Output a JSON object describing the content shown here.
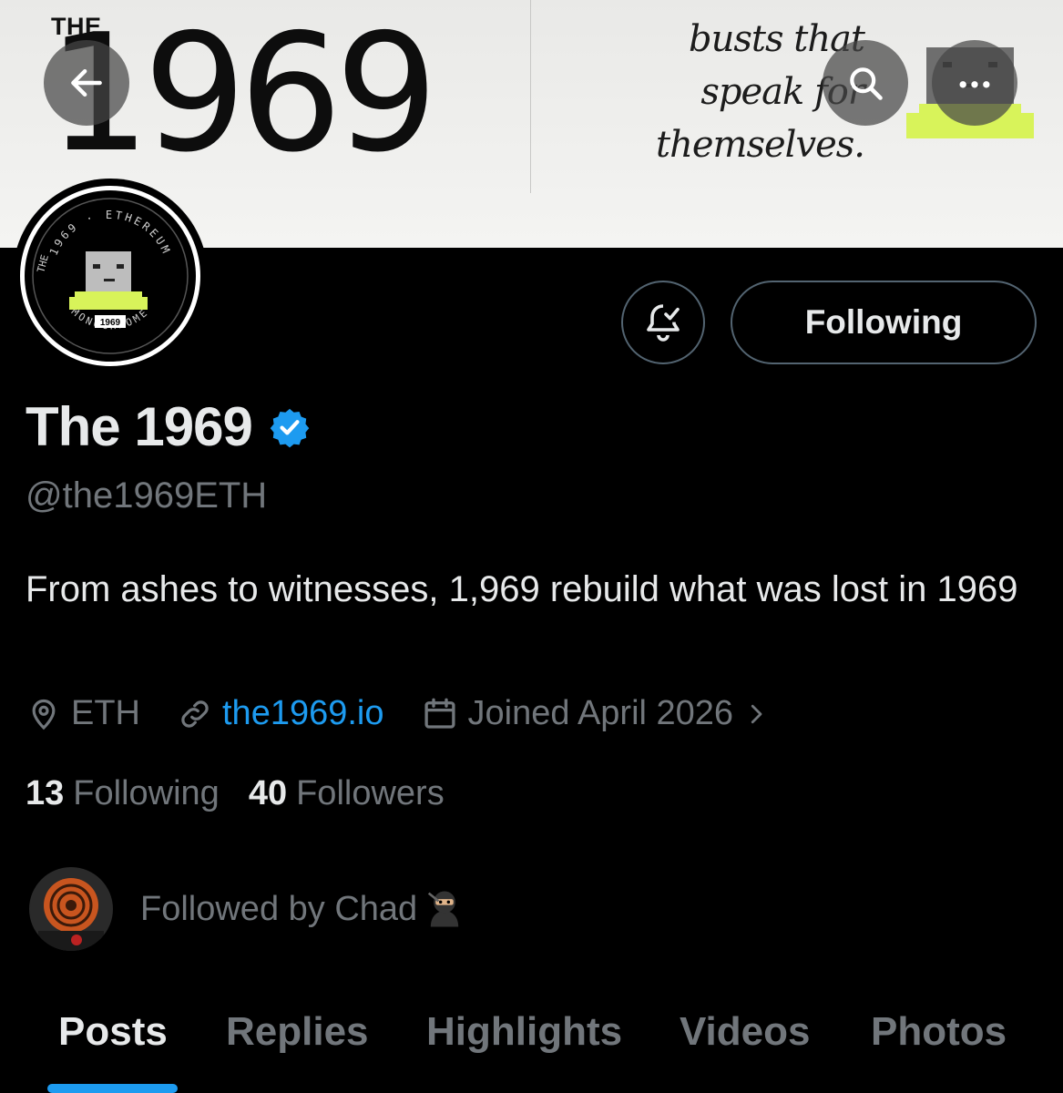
{
  "banner": {
    "the_label": "THE",
    "big_number": "1969",
    "tagline_lines": [
      "busts that",
      "speak for",
      "themselves."
    ]
  },
  "avatar_logo": {
    "ring_text_top": "1969 · ETHEREUM",
    "ring_text_left": "THE",
    "ring_text_bottom": "MONOCHROME",
    "badge": "1969"
  },
  "header_buttons": {
    "back_icon": "arrow-left-icon",
    "search_icon": "search-icon",
    "more_icon": "more-horizontal-icon"
  },
  "actions": {
    "notify_icon": "bell-check-icon",
    "following_label": "Following"
  },
  "profile": {
    "display_name": "The 1969",
    "verified": true,
    "handle": "@the1969ETH",
    "bio": "From ashes to witnesses, 1,969 rebuild what was lost in 1969",
    "location": "ETH",
    "website": "the1969.io",
    "joined": "Joined April 2026",
    "following_count": "13",
    "following_label": "Following",
    "followers_count": "40",
    "followers_label": "Followers",
    "followed_by_text": "Followed by Chad"
  },
  "tabs": [
    {
      "label": "Posts",
      "active": true
    },
    {
      "label": "Replies",
      "active": false
    },
    {
      "label": "Highlights",
      "active": false
    },
    {
      "label": "Videos",
      "active": false
    },
    {
      "label": "Photos",
      "active": false
    }
  ],
  "colors": {
    "background": "#000000",
    "accent_blue": "#1d9bf0",
    "muted_text": "#71767b",
    "primary_text": "#e7e9ea",
    "lime": "#d8f35a"
  }
}
